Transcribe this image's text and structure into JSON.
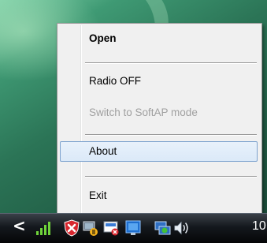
{
  "context_menu": {
    "items": [
      {
        "label": "Open",
        "bold": true
      },
      {
        "label": "Radio OFF"
      },
      {
        "label": "Switch to SoftAP mode",
        "disabled": true
      },
      {
        "label": "About",
        "highlighted": true
      },
      {
        "label": "Exit"
      }
    ]
  },
  "taskbar": {
    "clock_text": "10",
    "tray_icons": [
      "signal-strength-icon",
      "security-alert-icon",
      "network-tool-icon",
      "presentation-icon",
      "display-icon",
      "network-connection-icon",
      "volume-icon"
    ]
  },
  "colors": {
    "menu_background": "#f0f0f0",
    "highlight_border": "#7da2ce",
    "disabled_text": "#a0a0a0",
    "taskbar": "#0b0e12"
  }
}
